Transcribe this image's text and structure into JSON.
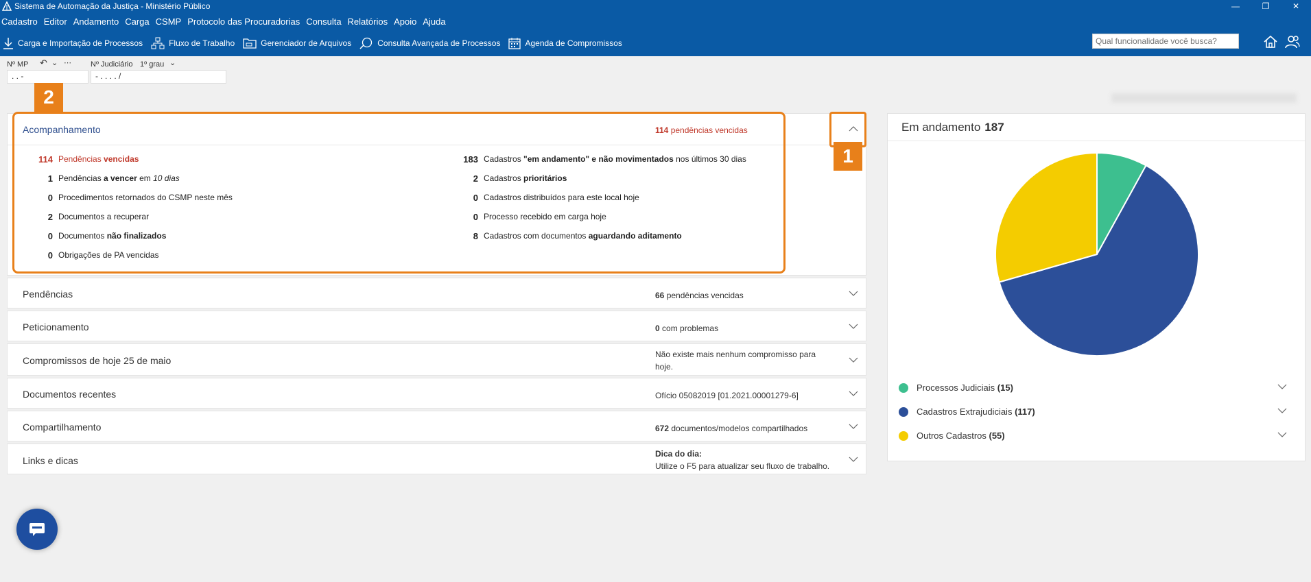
{
  "window": {
    "title": "Sistema de Automação da Justiça - Ministério Público",
    "controls": [
      "minimize-icon",
      "maximize-icon",
      "close-icon"
    ]
  },
  "menu": [
    "Cadastro",
    "Editor",
    "Andamento",
    "Carga",
    "CSMP",
    "Protocolo das Procuradorias",
    "Consulta",
    "Relatórios",
    "Apoio",
    "Ajuda"
  ],
  "toolbar": {
    "items": [
      {
        "label": "Carga e Importação de Processos",
        "icon": "download-icon"
      },
      {
        "label": "Fluxo de Trabalho",
        "icon": "workflow-icon"
      },
      {
        "label": "Gerenciador de Arquivos",
        "icon": "folder-icon"
      },
      {
        "label": "Consulta Avançada de Processos",
        "icon": "search-chat-icon"
      },
      {
        "label": "Agenda de Compromissos",
        "icon": "calendar-icon"
      }
    ],
    "search_placeholder": "Qual funcionalidade você busca?"
  },
  "fields": {
    "mp_label": "Nº MP",
    "mp_value": ". .     -",
    "judicial_label": "Nº Judiciário",
    "grau_label": "1º grau",
    "judicial_value": "- . . . .    /"
  },
  "accompaniment": {
    "title": "Acompanhamento",
    "summary_count": "114",
    "summary_text": "pendências vencidas",
    "left": [
      {
        "num": "114",
        "parts": [
          "Pendências ",
          "vencidas"
        ],
        "red": true
      },
      {
        "num": "1",
        "parts": [
          "Pendências ",
          "a vencer",
          " em ",
          "10 dias"
        ]
      },
      {
        "num": "0",
        "parts": [
          "Procedimentos retornados do CSMP neste mês"
        ]
      },
      {
        "num": "2",
        "parts": [
          "Documentos a recuperar"
        ]
      },
      {
        "num": "0",
        "parts": [
          "Documentos ",
          "não finalizados"
        ]
      },
      {
        "num": "0",
        "parts": [
          "Obrigações de PA vencidas"
        ]
      }
    ],
    "right": [
      {
        "num": "183",
        "parts": [
          "Cadastros ",
          "\"em andamento\" e não movimentados",
          " nos últimos 30 dias"
        ]
      },
      {
        "num": "2",
        "parts": [
          "Cadastros ",
          "prioritários"
        ]
      },
      {
        "num": "0",
        "parts": [
          "Cadastros distribuídos para este local hoje"
        ]
      },
      {
        "num": "0",
        "parts": [
          "Processo recebido em carga hoje"
        ]
      },
      {
        "num": "8",
        "parts": [
          "Cadastros com documentos ",
          "aguardando aditamento"
        ]
      }
    ]
  },
  "sections": {
    "pendencias": {
      "title": "Pendências",
      "count": "66",
      "text": "pendências vencidas"
    },
    "peticionamento": {
      "title": "Peticionamento",
      "count": "0",
      "text": "com problemas"
    },
    "compromissos": {
      "title": "Compromissos de hoje 25 de maio",
      "text": "Não existe mais nenhum compromisso para hoje."
    },
    "documentos": {
      "title": "Documentos recentes",
      "text": "Ofício 05082019 [01.2021.00001279-6]"
    },
    "compartilhamento": {
      "title": "Compartilhamento",
      "count": "672",
      "text": "documentos/modelos compartilhados"
    },
    "links": {
      "title": "Links e dicas",
      "heading": "Dica do dia:",
      "text": "Utilize o F5 para atualizar seu fluxo de trabalho."
    }
  },
  "callouts": {
    "one": "1",
    "two": "2"
  },
  "chart_data": {
    "type": "pie",
    "title": "Em andamento",
    "total": "187",
    "categories": [
      "Processos Judiciais",
      "Cadastros Extrajudiciais",
      "Outros Cadastros"
    ],
    "values": [
      15,
      117,
      55
    ],
    "labels": [
      "(15)",
      "(117)",
      "(55)"
    ],
    "colors": [
      "#3dbf8f",
      "#2c4f99",
      "#f4cc00"
    ]
  },
  "colors": {
    "brand": "#0a5aa5",
    "accent_highlight": "#e8801a",
    "alert": "#c0392b"
  }
}
